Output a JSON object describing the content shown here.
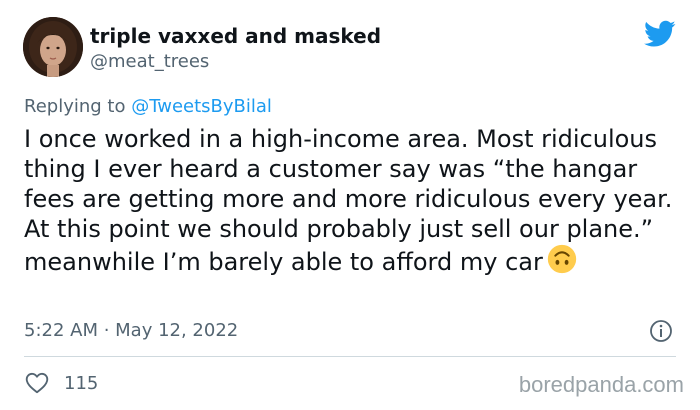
{
  "author": {
    "display_name": "triple vaxxed and masked",
    "handle": "@meat_trees",
    "avatar_icon": "portrait-avatar"
  },
  "reply": {
    "prefix": "Replying to ",
    "mention": "@TweetsByBilal"
  },
  "tweet": {
    "text": "I once worked in a high-income area. Most ridiculous thing I ever heard a customer say was “the hangar fees are getting more and more ridiculous every year. At this point we should probably just sell our plane.” meanwhile I’m barely able to afford my car",
    "emoji": "upside-down-face-emoji",
    "timestamp": "5:22 AM · May 12, 2022"
  },
  "engagement": {
    "likes": "115"
  },
  "watermark": "boredpanda.com",
  "colors": {
    "brand_blue": "#1d9bf0",
    "text": "#0f1419",
    "secondary_text": "#536471",
    "divider": "#cfd9de"
  }
}
